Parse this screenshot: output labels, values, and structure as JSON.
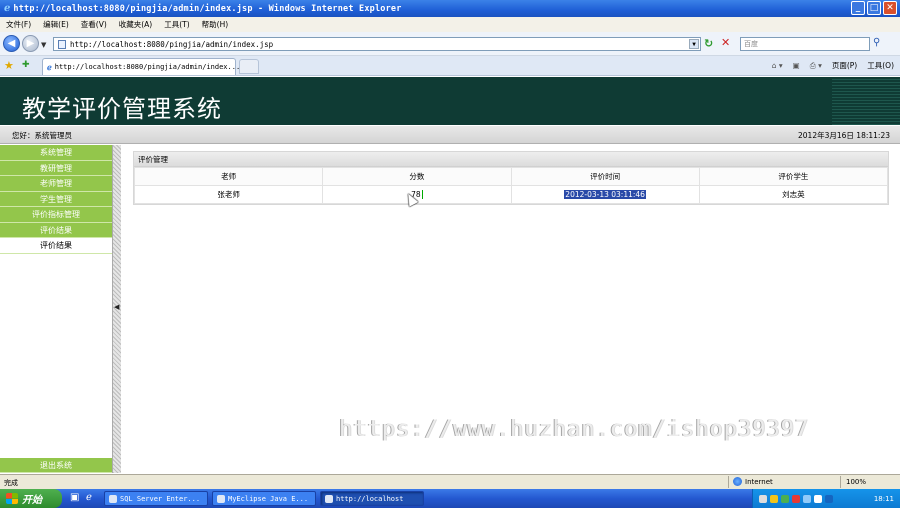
{
  "window": {
    "title": "http://localhost:8080/pingjia/admin/index.jsp - Windows Internet Explorer",
    "buttons": {
      "minimize": "_",
      "maximize": "□",
      "close": "✕"
    }
  },
  "menu": [
    "文件(F)",
    "编辑(E)",
    "查看(V)",
    "收藏夹(A)",
    "工具(T)",
    "帮助(H)"
  ],
  "address": {
    "url": "http://localhost:8080/pingjia/admin/index.jsp",
    "search_placeholder": "百度"
  },
  "tab": {
    "label": "http://localhost:8080/pingjia/admin/index..."
  },
  "toolbar": {
    "page": "页面(P)",
    "tools": "工具(O)"
  },
  "app": {
    "title": "教学评价管理系统",
    "greeting": "您好：系统管理员",
    "clock": "2012年3月16日  18:11:23"
  },
  "sidebar": {
    "items": [
      "系统管理",
      "教研管理",
      "老师管理",
      "学生管理",
      "评价指标管理",
      "评价结果",
      "评价结果"
    ],
    "logout": "退出系统"
  },
  "panel": {
    "title": "评价管理",
    "columns": [
      "老师",
      "分数",
      "评价时间",
      "评价学生"
    ],
    "rows": [
      {
        "teacher": "张老师",
        "score": "78",
        "time": "2012-03-13 03:11:46",
        "student": "刘志英"
      }
    ]
  },
  "watermark": "https://www.huzhan.com/ishop39397",
  "status": {
    "left": "完成",
    "zone": "Internet",
    "zoom": "100%"
  },
  "taskbar": {
    "start": "开始",
    "tasks": [
      "SQL Server Enter...",
      "MyEclipse Java E...",
      "http://localhost"
    ],
    "time": "18:11"
  },
  "colors": {
    "header_bg": "#0f3b34",
    "sidebar_green": "#93c64b",
    "selection": "#2a4aa8"
  }
}
